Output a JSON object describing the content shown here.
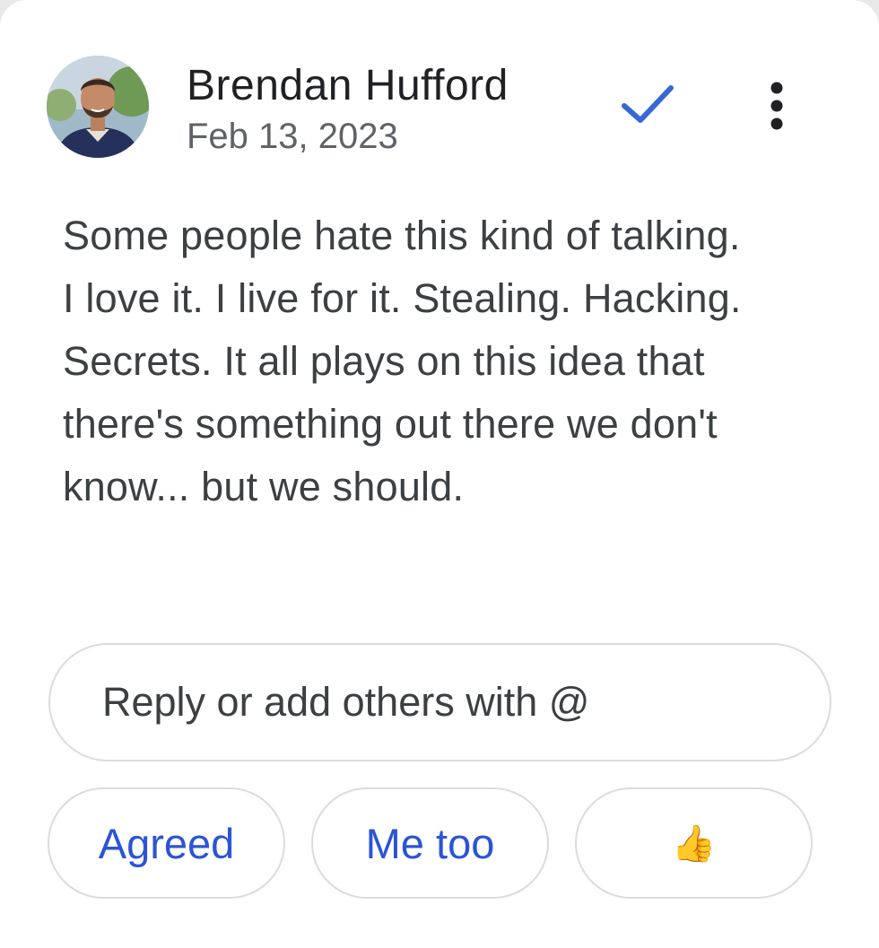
{
  "comment": {
    "author": "Brendan Hufford",
    "date": "Feb 13, 2023",
    "body": "Some people hate this kind of talking. I love it. I live for it. Stealing. Hacking. Secrets. It all plays on this idea that there's something out there we don't know... but we should.",
    "avatar_icon": "user-photo-avatar",
    "resolve_icon": "checkmark-icon",
    "more_icon": "more-vert-icon"
  },
  "reply": {
    "placeholder": "Reply or add others with @",
    "value": ""
  },
  "quick_replies": [
    {
      "label": "Agreed"
    },
    {
      "label": "Me too"
    },
    {
      "label": "👍"
    }
  ],
  "colors": {
    "accent": "#2b54d6",
    "checkmark": "#3867d6",
    "text_primary": "#202124",
    "text_secondary": "#5f6368",
    "border": "#dadce0"
  }
}
